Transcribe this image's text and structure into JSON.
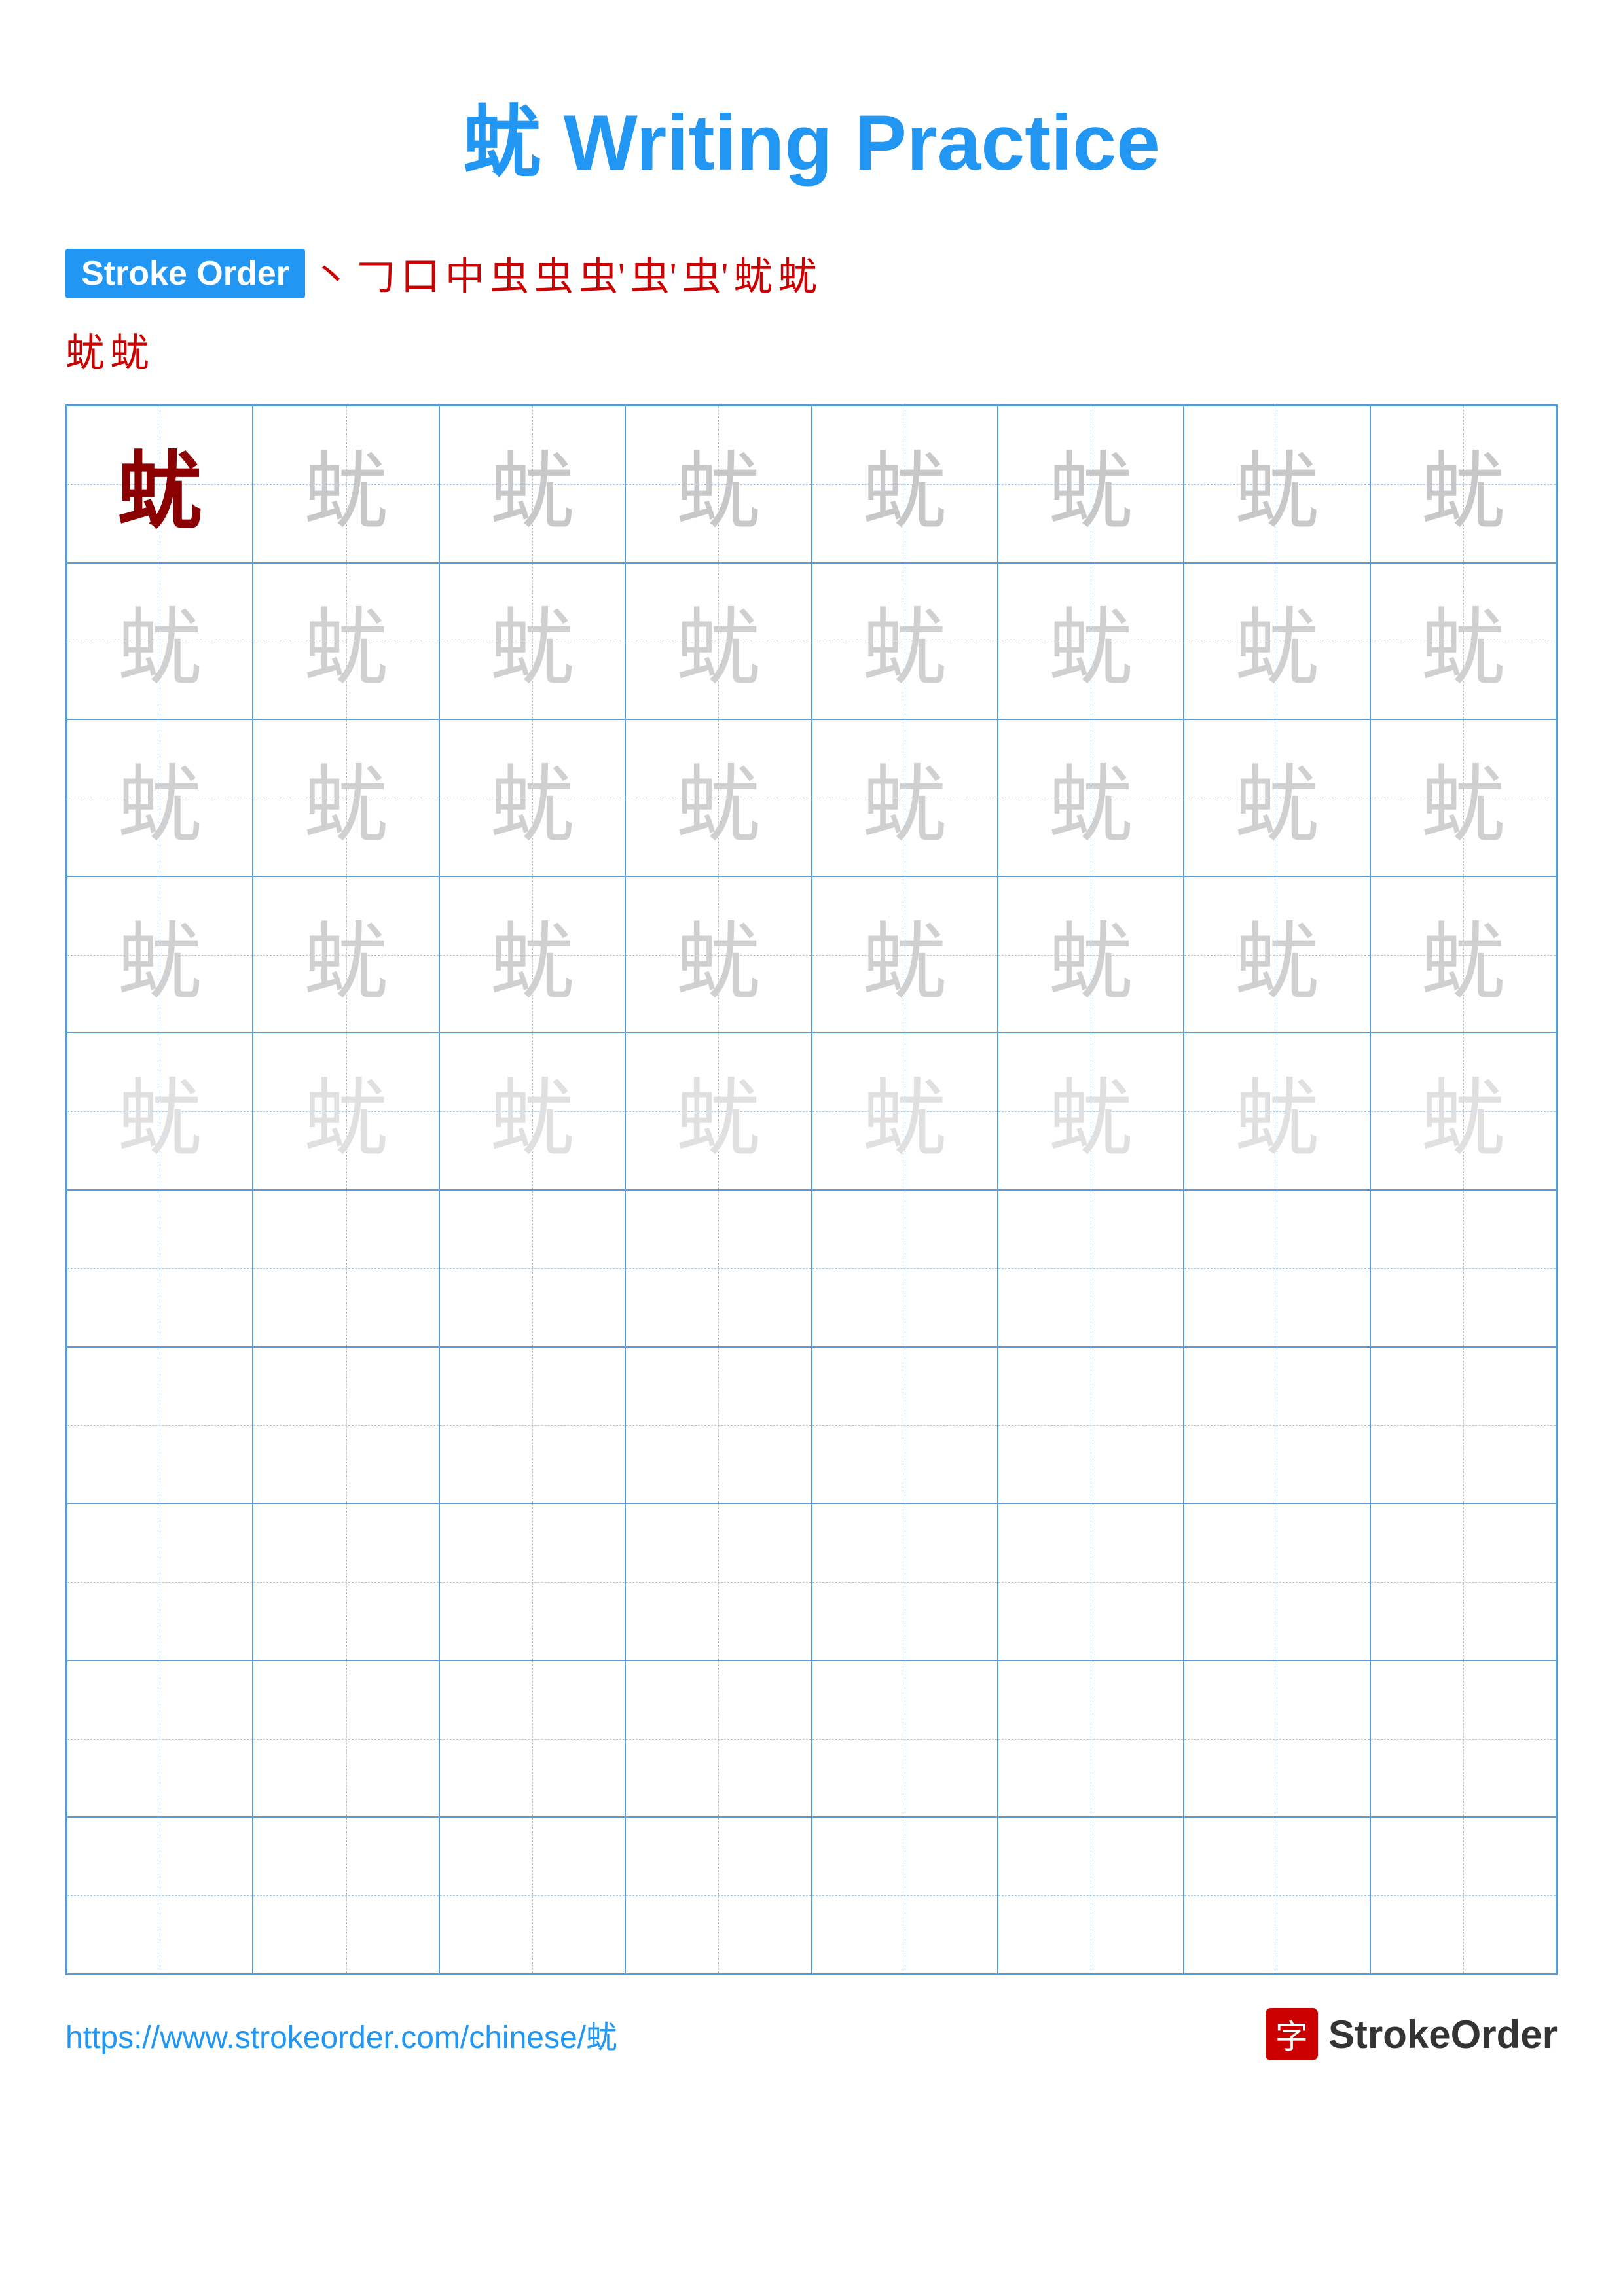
{
  "title": {
    "char": "蚘",
    "label": "Writing Practice",
    "full": "蚘 Writing Practice"
  },
  "stroke_order": {
    "badge": "Stroke Order",
    "strokes": [
      "丶",
      "𠃌",
      "口",
      "中",
      "虫",
      "虫",
      "虫'",
      "虫'",
      "虫'",
      "蚘",
      "蚘"
    ],
    "last_row": [
      "蚘",
      "蚘"
    ]
  },
  "grid": {
    "cols": 8,
    "rows": 10,
    "char": "蚘",
    "filled_rows": 5
  },
  "footer": {
    "url": "https://www.strokeorder.com/chinese/蚘",
    "brand": "StrokeOrder",
    "logo_char": "字"
  }
}
